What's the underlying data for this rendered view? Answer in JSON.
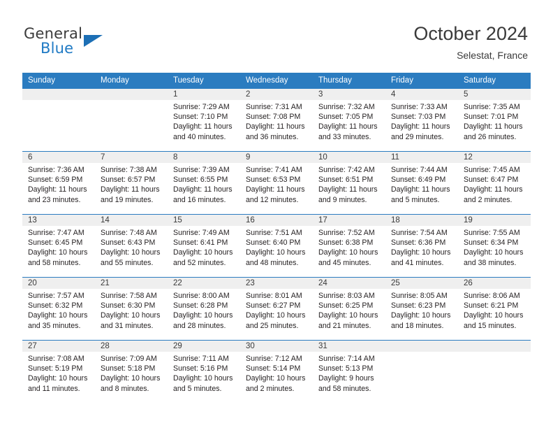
{
  "brand": {
    "name_top": "General",
    "name_bottom": "Blue",
    "triangle_color": "#1c6fb5",
    "blue_color": "#1f7ac4",
    "gray_color": "#3b3b3b"
  },
  "header": {
    "title": "October 2024",
    "subtitle": "Selestat, France",
    "accent_color": "#2b7cc0",
    "daynum_band_color": "#efefef"
  },
  "weekday_headers": [
    "Sunday",
    "Monday",
    "Tuesday",
    "Wednesday",
    "Thursday",
    "Friday",
    "Saturday"
  ],
  "weeks": [
    [
      {
        "day": "",
        "sunrise": "",
        "sunset": "",
        "daylight_line1": "",
        "daylight_line2": "",
        "empty": true
      },
      {
        "day": "",
        "sunrise": "",
        "sunset": "",
        "daylight_line1": "",
        "daylight_line2": "",
        "empty": true
      },
      {
        "day": "1",
        "sunrise": "Sunrise: 7:29 AM",
        "sunset": "Sunset: 7:10 PM",
        "daylight_line1": "Daylight: 11 hours",
        "daylight_line2": "and 40 minutes.",
        "empty": false
      },
      {
        "day": "2",
        "sunrise": "Sunrise: 7:31 AM",
        "sunset": "Sunset: 7:08 PM",
        "daylight_line1": "Daylight: 11 hours",
        "daylight_line2": "and 36 minutes.",
        "empty": false
      },
      {
        "day": "3",
        "sunrise": "Sunrise: 7:32 AM",
        "sunset": "Sunset: 7:05 PM",
        "daylight_line1": "Daylight: 11 hours",
        "daylight_line2": "and 33 minutes.",
        "empty": false
      },
      {
        "day": "4",
        "sunrise": "Sunrise: 7:33 AM",
        "sunset": "Sunset: 7:03 PM",
        "daylight_line1": "Daylight: 11 hours",
        "daylight_line2": "and 29 minutes.",
        "empty": false
      },
      {
        "day": "5",
        "sunrise": "Sunrise: 7:35 AM",
        "sunset": "Sunset: 7:01 PM",
        "daylight_line1": "Daylight: 11 hours",
        "daylight_line2": "and 26 minutes.",
        "empty": false
      }
    ],
    [
      {
        "day": "6",
        "sunrise": "Sunrise: 7:36 AM",
        "sunset": "Sunset: 6:59 PM",
        "daylight_line1": "Daylight: 11 hours",
        "daylight_line2": "and 23 minutes.",
        "empty": false
      },
      {
        "day": "7",
        "sunrise": "Sunrise: 7:38 AM",
        "sunset": "Sunset: 6:57 PM",
        "daylight_line1": "Daylight: 11 hours",
        "daylight_line2": "and 19 minutes.",
        "empty": false
      },
      {
        "day": "8",
        "sunrise": "Sunrise: 7:39 AM",
        "sunset": "Sunset: 6:55 PM",
        "daylight_line1": "Daylight: 11 hours",
        "daylight_line2": "and 16 minutes.",
        "empty": false
      },
      {
        "day": "9",
        "sunrise": "Sunrise: 7:41 AM",
        "sunset": "Sunset: 6:53 PM",
        "daylight_line1": "Daylight: 11 hours",
        "daylight_line2": "and 12 minutes.",
        "empty": false
      },
      {
        "day": "10",
        "sunrise": "Sunrise: 7:42 AM",
        "sunset": "Sunset: 6:51 PM",
        "daylight_line1": "Daylight: 11 hours",
        "daylight_line2": "and 9 minutes.",
        "empty": false
      },
      {
        "day": "11",
        "sunrise": "Sunrise: 7:44 AM",
        "sunset": "Sunset: 6:49 PM",
        "daylight_line1": "Daylight: 11 hours",
        "daylight_line2": "and 5 minutes.",
        "empty": false
      },
      {
        "day": "12",
        "sunrise": "Sunrise: 7:45 AM",
        "sunset": "Sunset: 6:47 PM",
        "daylight_line1": "Daylight: 11 hours",
        "daylight_line2": "and 2 minutes.",
        "empty": false
      }
    ],
    [
      {
        "day": "13",
        "sunrise": "Sunrise: 7:47 AM",
        "sunset": "Sunset: 6:45 PM",
        "daylight_line1": "Daylight: 10 hours",
        "daylight_line2": "and 58 minutes.",
        "empty": false
      },
      {
        "day": "14",
        "sunrise": "Sunrise: 7:48 AM",
        "sunset": "Sunset: 6:43 PM",
        "daylight_line1": "Daylight: 10 hours",
        "daylight_line2": "and 55 minutes.",
        "empty": false
      },
      {
        "day": "15",
        "sunrise": "Sunrise: 7:49 AM",
        "sunset": "Sunset: 6:41 PM",
        "daylight_line1": "Daylight: 10 hours",
        "daylight_line2": "and 52 minutes.",
        "empty": false
      },
      {
        "day": "16",
        "sunrise": "Sunrise: 7:51 AM",
        "sunset": "Sunset: 6:40 PM",
        "daylight_line1": "Daylight: 10 hours",
        "daylight_line2": "and 48 minutes.",
        "empty": false
      },
      {
        "day": "17",
        "sunrise": "Sunrise: 7:52 AM",
        "sunset": "Sunset: 6:38 PM",
        "daylight_line1": "Daylight: 10 hours",
        "daylight_line2": "and 45 minutes.",
        "empty": false
      },
      {
        "day": "18",
        "sunrise": "Sunrise: 7:54 AM",
        "sunset": "Sunset: 6:36 PM",
        "daylight_line1": "Daylight: 10 hours",
        "daylight_line2": "and 41 minutes.",
        "empty": false
      },
      {
        "day": "19",
        "sunrise": "Sunrise: 7:55 AM",
        "sunset": "Sunset: 6:34 PM",
        "daylight_line1": "Daylight: 10 hours",
        "daylight_line2": "and 38 minutes.",
        "empty": false
      }
    ],
    [
      {
        "day": "20",
        "sunrise": "Sunrise: 7:57 AM",
        "sunset": "Sunset: 6:32 PM",
        "daylight_line1": "Daylight: 10 hours",
        "daylight_line2": "and 35 minutes.",
        "empty": false
      },
      {
        "day": "21",
        "sunrise": "Sunrise: 7:58 AM",
        "sunset": "Sunset: 6:30 PM",
        "daylight_line1": "Daylight: 10 hours",
        "daylight_line2": "and 31 minutes.",
        "empty": false
      },
      {
        "day": "22",
        "sunrise": "Sunrise: 8:00 AM",
        "sunset": "Sunset: 6:28 PM",
        "daylight_line1": "Daylight: 10 hours",
        "daylight_line2": "and 28 minutes.",
        "empty": false
      },
      {
        "day": "23",
        "sunrise": "Sunrise: 8:01 AM",
        "sunset": "Sunset: 6:27 PM",
        "daylight_line1": "Daylight: 10 hours",
        "daylight_line2": "and 25 minutes.",
        "empty": false
      },
      {
        "day": "24",
        "sunrise": "Sunrise: 8:03 AM",
        "sunset": "Sunset: 6:25 PM",
        "daylight_line1": "Daylight: 10 hours",
        "daylight_line2": "and 21 minutes.",
        "empty": false
      },
      {
        "day": "25",
        "sunrise": "Sunrise: 8:05 AM",
        "sunset": "Sunset: 6:23 PM",
        "daylight_line1": "Daylight: 10 hours",
        "daylight_line2": "and 18 minutes.",
        "empty": false
      },
      {
        "day": "26",
        "sunrise": "Sunrise: 8:06 AM",
        "sunset": "Sunset: 6:21 PM",
        "daylight_line1": "Daylight: 10 hours",
        "daylight_line2": "and 15 minutes.",
        "empty": false
      }
    ],
    [
      {
        "day": "27",
        "sunrise": "Sunrise: 7:08 AM",
        "sunset": "Sunset: 5:19 PM",
        "daylight_line1": "Daylight: 10 hours",
        "daylight_line2": "and 11 minutes.",
        "empty": false
      },
      {
        "day": "28",
        "sunrise": "Sunrise: 7:09 AM",
        "sunset": "Sunset: 5:18 PM",
        "daylight_line1": "Daylight: 10 hours",
        "daylight_line2": "and 8 minutes.",
        "empty": false
      },
      {
        "day": "29",
        "sunrise": "Sunrise: 7:11 AM",
        "sunset": "Sunset: 5:16 PM",
        "daylight_line1": "Daylight: 10 hours",
        "daylight_line2": "and 5 minutes.",
        "empty": false
      },
      {
        "day": "30",
        "sunrise": "Sunrise: 7:12 AM",
        "sunset": "Sunset: 5:14 PM",
        "daylight_line1": "Daylight: 10 hours",
        "daylight_line2": "and 2 minutes.",
        "empty": false
      },
      {
        "day": "31",
        "sunrise": "Sunrise: 7:14 AM",
        "sunset": "Sunset: 5:13 PM",
        "daylight_line1": "Daylight: 9 hours",
        "daylight_line2": "and 58 minutes.",
        "empty": false
      },
      {
        "day": "",
        "sunrise": "",
        "sunset": "",
        "daylight_line1": "",
        "daylight_line2": "",
        "empty": true
      },
      {
        "day": "",
        "sunrise": "",
        "sunset": "",
        "daylight_line1": "",
        "daylight_line2": "",
        "empty": true
      }
    ]
  ]
}
